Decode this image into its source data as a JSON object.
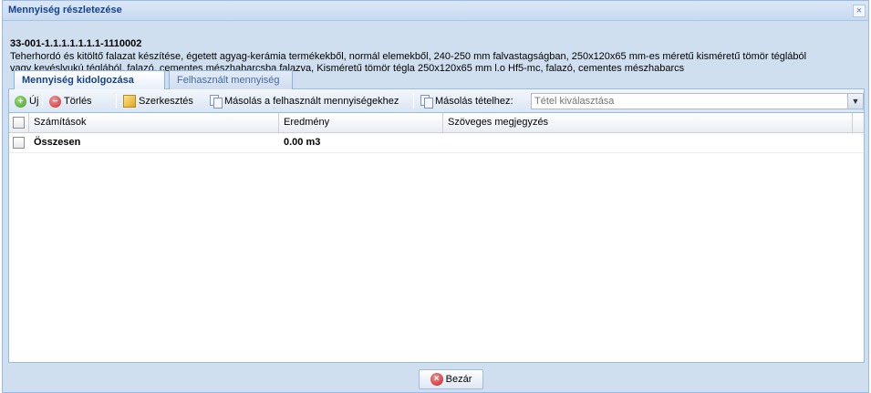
{
  "window": {
    "title": "Mennyiség részletezése",
    "close_glyph": "×"
  },
  "item": {
    "code": "33-001-1.1.1.1.1.1.1-1110002",
    "description_line1": "Teherhordó és kitöltő falazat készítése, égetett agyag-kerámia termékekből, normál elemekből, 240-250 mm falvastagságban, 250x120x65 mm-es méretű kisméretű tömör téglából",
    "description_line2": "vagy kevéslyukú téglából, falazó, cementes mészhabarcsba falazva, Kisméretű tömör tégla 250x120x65 mm l.o Hf5-mc, falazó, cementes mészhabarcs"
  },
  "tabs": [
    {
      "label": "Mennyiség kidolgozása",
      "active": true
    },
    {
      "label": "Felhasznált mennyiség",
      "active": false
    }
  ],
  "toolbar": {
    "new_label": "Új",
    "delete_label": "Törlés",
    "edit_label": "Szerkesztés",
    "copy_to_used_label": "Másolás a felhasznált mennyiségekhez",
    "copy_to_item_label": "Másolás tételhez:",
    "item_select_placeholder": "Tétel kiválasztása",
    "new_icon": "add-icon",
    "delete_icon": "delete-icon",
    "edit_icon": "edit-icon",
    "copy_icon": "copy-icon"
  },
  "grid": {
    "columns": [
      "Számítások",
      "Eredmény",
      "Szöveges megjegyzés"
    ],
    "rows": [
      {
        "calculation": "Összesen",
        "result": "0.00 m3",
        "note": ""
      }
    ]
  },
  "footer": {
    "close_label": "Bezár",
    "close_icon": "close-circle-icon"
  },
  "colors": {
    "title": "#15428b",
    "border": "#99bbe8",
    "window_bg": "#cfdfef"
  }
}
